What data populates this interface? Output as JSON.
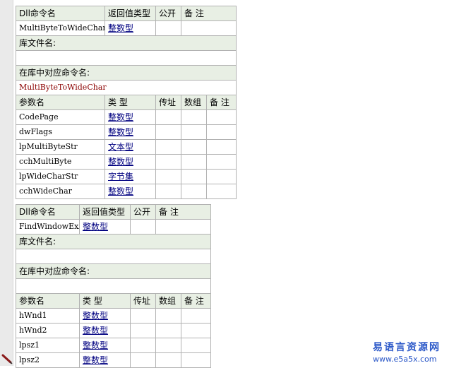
{
  "headers": {
    "dll_name": "Dll命令名",
    "return_type": "返回值类型",
    "public": "公开",
    "remark": "备 注",
    "lib_file": "库文件名:",
    "lib_cmd": "在库中对应命令名:",
    "param_name": "参数名",
    "type": "类 型",
    "by_ref": "传址",
    "array": "数组"
  },
  "dlls": [
    {
      "name": "MultiByteToWideChar",
      "return_type": "整数型",
      "lib_file": "",
      "lib_cmd": "MultiByteToWideChar",
      "params": [
        {
          "name": "CodePage",
          "type": "整数型"
        },
        {
          "name": "dwFlags",
          "type": "整数型"
        },
        {
          "name": "lpMultiByteStr",
          "type": "文本型"
        },
        {
          "name": "cchMultiByte",
          "type": "整数型"
        },
        {
          "name": "lpWideCharStr",
          "type": "字节集"
        },
        {
          "name": "cchWideChar",
          "type": "整数型"
        }
      ]
    },
    {
      "name": "FindWindowExA",
      "return_type": "整数型",
      "lib_file": "",
      "lib_cmd": "",
      "params": [
        {
          "name": "hWnd1",
          "type": "整数型"
        },
        {
          "name": "hWnd2",
          "type": "整数型"
        },
        {
          "name": "lpsz1",
          "type": "整数型"
        },
        {
          "name": "lpsz2",
          "type": "整数型"
        }
      ]
    }
  ],
  "watermark": {
    "title": "易语言资源网",
    "url": "www.e5a5x.com"
  },
  "colors": {
    "header_bg": "#e8efe4",
    "border": "#b2b2b2",
    "type_link": "#000080",
    "value_text": "#8b0000",
    "watermark": "#2b58c8"
  },
  "icons": {
    "edit": "pencil-icon"
  }
}
